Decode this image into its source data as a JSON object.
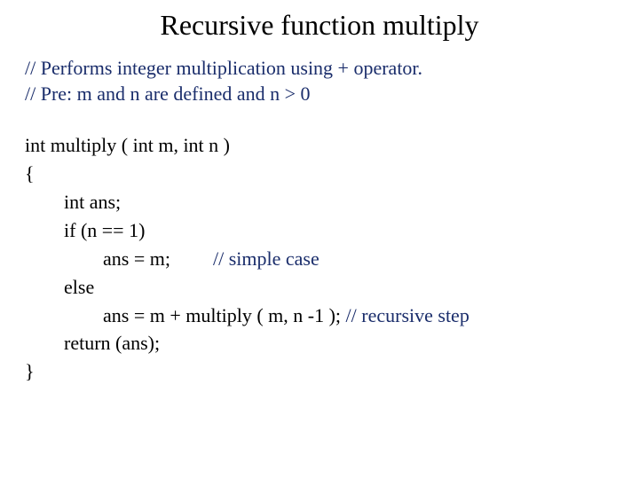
{
  "title": "Recursive function multiply",
  "comments": {
    "line1": "// Performs integer multiplication using + operator.",
    "line2": "// Pre: m and n are defined and n > 0"
  },
  "code": {
    "fn_decl": "int multiply ( int m, int n )",
    "brace_open": "{",
    "var_decl": "int ans;",
    "if_stmt": "if (n == 1)",
    "simple_assign": "ans = m;",
    "simple_comment": "// simple case",
    "else_stmt": "else",
    "recursive_assign": "ans = m + multiply ( m, n -1 ); ",
    "recursive_comment": "// recursive step",
    "return_stmt": "return (ans);",
    "brace_close": "}"
  }
}
